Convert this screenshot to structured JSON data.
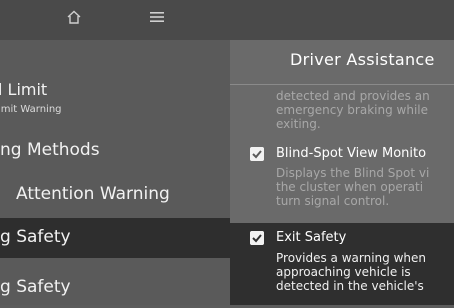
{
  "topbar": {
    "home_icon": "home-icon",
    "menu_icon": "menu-icon"
  },
  "sidebar": {
    "items": [
      {
        "label": "l Limit",
        "sub": "imit Warning"
      },
      {
        "label": "ng Methods"
      },
      {
        "label": "Attention Warning"
      },
      {
        "label": "g Safety",
        "active": true
      },
      {
        "label": "g Safety"
      }
    ]
  },
  "panel": {
    "title": "Driver Assistance",
    "intro_lines": [
      "detected and provides an",
      "emergency braking while",
      "exiting."
    ],
    "options": [
      {
        "label": "Blind-Spot View Monito",
        "checked": true,
        "desc": [
          "Displays the Blind Spot vi",
          "the cluster when operati",
          "turn signal control."
        ]
      },
      {
        "label": "Exit Safety",
        "checked": true,
        "desc": [
          "Provides a warning when",
          "approaching vehicle is",
          "detected in the vehicle's"
        ]
      }
    ]
  }
}
